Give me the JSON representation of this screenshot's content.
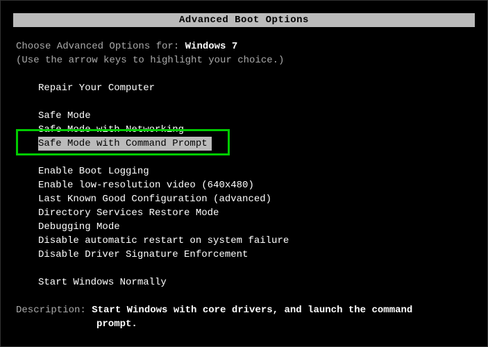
{
  "title": "Advanced Boot Options",
  "prompt_prefix": "Choose Advanced Options for: ",
  "os_name": "Windows 7",
  "instruction": "(Use the arrow keys to highlight your choice.)",
  "options": {
    "repair": "Repair Your Computer",
    "safe_mode": "Safe Mode",
    "safe_mode_net": "Safe Mode with Networking",
    "safe_mode_cmd": "Safe Mode with Command Prompt",
    "boot_log": "Enable Boot Logging",
    "low_res": "Enable low-resolution video (640x480)",
    "lkgc": "Last Known Good Configuration (advanced)",
    "ds_restore": "Directory Services Restore Mode",
    "debug": "Debugging Mode",
    "no_restart": "Disable automatic restart on system failure",
    "no_sig": "Disable Driver Signature Enforcement",
    "start_normal": "Start Windows Normally"
  },
  "desc_label": "Description: ",
  "desc_line1": "Start Windows with core drivers, and launch the command",
  "desc_line2": "prompt."
}
